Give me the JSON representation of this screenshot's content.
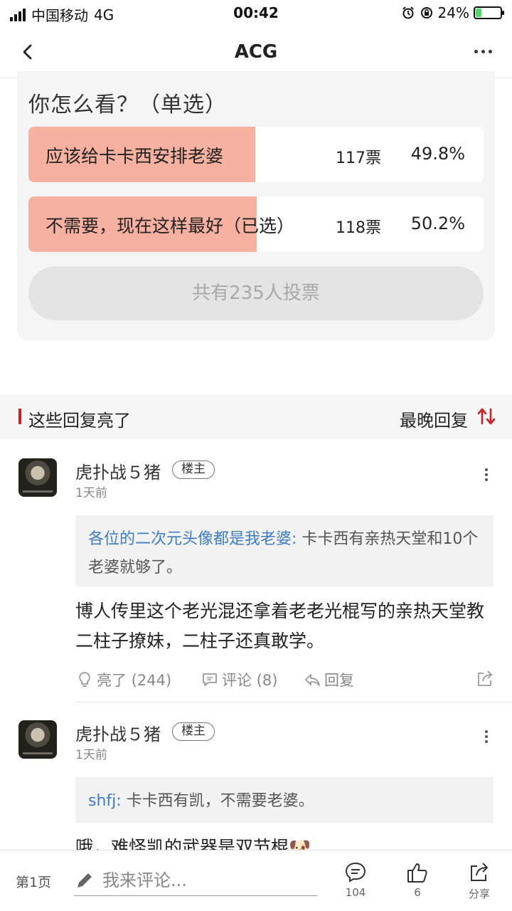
{
  "status_bar": {
    "carrier": "中国移动",
    "network": "4G",
    "time": "00:42",
    "battery": "24%",
    "battery_level": 0.24
  },
  "nav": {
    "title": "ACG"
  },
  "poll": {
    "question": "你怎么看？（单选）",
    "options": [
      {
        "label": "应该给卡卡西安排老婆",
        "votes": "117票",
        "percent": "49.8%",
        "fraction": 0.498
      },
      {
        "label": "不需要，现在这样最好（已选）",
        "votes": "118票",
        "percent": "50.2%",
        "fraction": 0.502
      }
    ],
    "total": "共有235人投票"
  },
  "section": {
    "title": "这些回复亮了",
    "sort_label": "最晚回复"
  },
  "comments": [
    {
      "username": "虎扑战５猪",
      "badge": "楼主",
      "time": "1天前",
      "quote_author": "各位的二次元头像都是我老婆:",
      "quote_text": " 卡卡西有亲热天堂和10个老婆就够了。",
      "text": "博人传里这个老光混还拿着老老光棍写的亲热天堂教二柱子撩妹，二柱子还真敢学。",
      "likes": "亮了 (244)",
      "replies": "评论 (8)",
      "reply": "回复"
    },
    {
      "username": "虎扑战５猪",
      "badge": "楼主",
      "time": "1天前",
      "quote_author": "shfj:",
      "quote_text": " 卡卡西有凯，不需要老婆。",
      "text": "哦，难怪凯的武器是双节棍🐶"
    }
  ],
  "bottom_bar": {
    "page": "第1页",
    "placeholder": "我来评论...",
    "comment_count": "104",
    "like_count": "6",
    "share": "分享"
  },
  "colors": {
    "poll_fill": "#f7b1a1",
    "accent_red": "#d02020",
    "link_blue": "#3d7cc9"
  }
}
